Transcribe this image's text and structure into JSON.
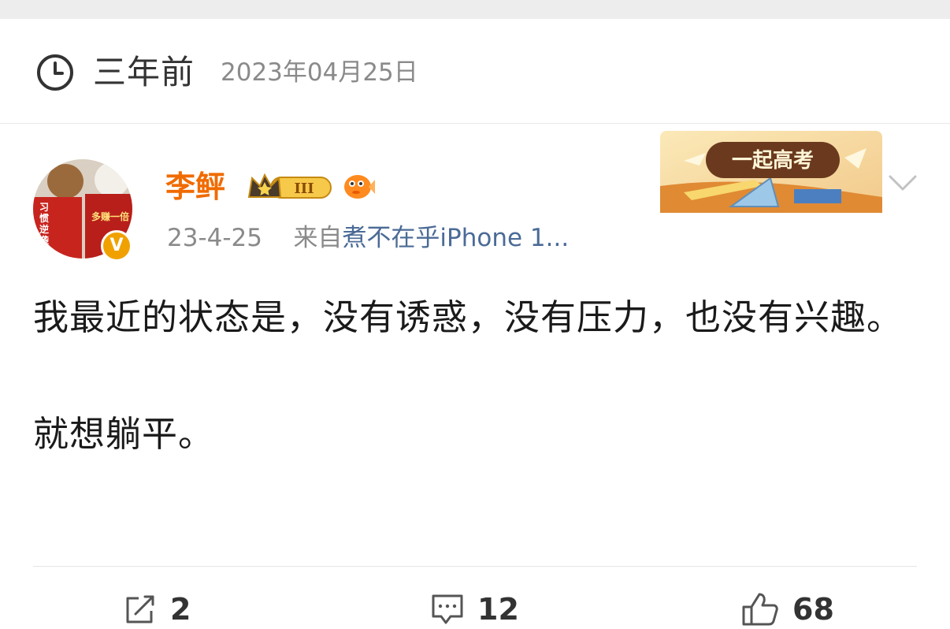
{
  "header": {
    "relative_time": "三年前",
    "absolute_date": "2023年04月25日"
  },
  "post": {
    "author": "李鲆",
    "verified_mark": "V",
    "vip_level": "III",
    "date": "23-4-25",
    "source_prefix": "来自",
    "source_device": "煮不在乎iPhone 1...",
    "banner_text": "一起高考",
    "content_line1": "我最近的状态是，没有诱惑，没有压力，也没有兴趣。",
    "content_line2": "就想躺平。"
  },
  "avatar": {
    "book1_title": "习惯逆袭",
    "book2_title": "多赚一倍"
  },
  "actions": {
    "repost_count": "2",
    "comment_count": "12",
    "like_count": "68"
  },
  "colors": {
    "username": "#f06b00",
    "device_link": "#4b6b96",
    "meta_gray": "#8a8a8a",
    "verified_badge": "#f0a100"
  },
  "icons": [
    "clock-icon",
    "crown-vip-badge-icon",
    "fish-badge-icon",
    "chevron-down-icon",
    "repost-icon",
    "comment-icon",
    "like-icon"
  ]
}
